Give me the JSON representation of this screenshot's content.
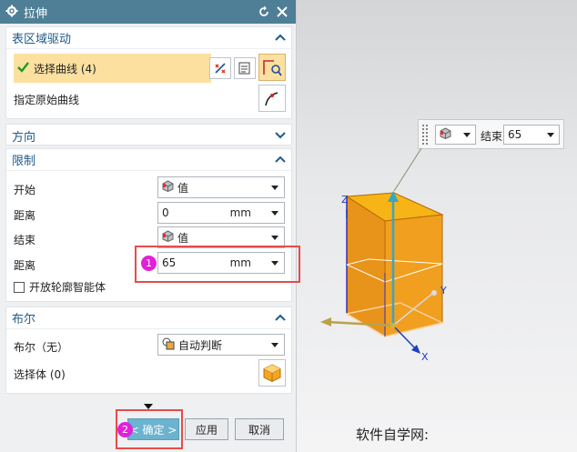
{
  "dialog": {
    "title": "拉伸",
    "sections": {
      "section_drive": {
        "title": "表区域驱动",
        "select_curve_label": "选择曲线 (4)",
        "specify_original_curve_label": "指定原始曲线"
      },
      "direction": {
        "title": "方向"
      },
      "limits": {
        "title": "限制",
        "start_label": "开始",
        "start_value": "值",
        "distance1_label": "距离",
        "distance1_value": "0",
        "distance1_unit": "mm",
        "end_label": "结束",
        "end_value": "值",
        "distance2_label": "距离",
        "distance2_value": "65",
        "distance2_unit": "mm",
        "open_profile_label": "开放轮廓智能体"
      },
      "boolean": {
        "title": "布尔",
        "boolean_label": "布尔（无）",
        "boolean_value": "自动判断",
        "select_body_label": "选择体 (0)"
      }
    },
    "buttons": {
      "ok": "< 确定 >",
      "apply": "应用",
      "cancel": "取消"
    },
    "badges": {
      "first": "1",
      "second": "2"
    }
  },
  "floating_toolbar": {
    "end_label": "结束",
    "end_value": "65"
  },
  "canvas": {
    "axis_x": "X",
    "axis_y": "Y",
    "axis_z": "Z"
  },
  "watermark": "软件自学网:",
  "colors": {
    "title_bar": "#4f7f96",
    "section_title": "#1f5a8a",
    "selection_highlight": "#fbe0a0",
    "annotation_red": "#e64b4b",
    "badge_magenta": "#e21fd9",
    "ok_button": "#6bb3cf",
    "solid_orange": "#f0a81c"
  }
}
